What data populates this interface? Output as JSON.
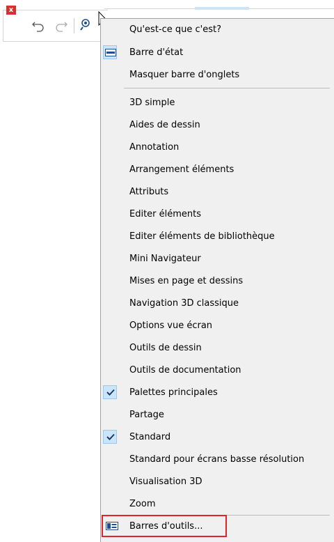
{
  "toolbar": {
    "close_glyph": "x",
    "icons": [
      "close-icon",
      "undo-icon",
      "redo-icon",
      "zoom-icon",
      "cursor-icon",
      "help-question-icon"
    ]
  },
  "menu": {
    "top_items": [
      {
        "label": "Qu'est-ce que c'est?",
        "icon": "help-question-icon"
      },
      {
        "label": "Barre d'état",
        "icon": "status-bar-icon",
        "highlighted": true
      },
      {
        "label": "Masquer barre d'onglets"
      }
    ],
    "items": [
      {
        "label": "3D simple"
      },
      {
        "label": "Aides de dessin"
      },
      {
        "label": "Annotation"
      },
      {
        "label": "Arrangement éléments"
      },
      {
        "label": "Attributs"
      },
      {
        "label": "Editer éléments"
      },
      {
        "label": "Editer éléments de bibliothèque"
      },
      {
        "label": "Mini Navigateur"
      },
      {
        "label": "Mises en page et dessins"
      },
      {
        "label": "Navigation 3D classique"
      },
      {
        "label": "Options vue écran"
      },
      {
        "label": "Outils de dessin"
      },
      {
        "label": "Outils de documentation"
      },
      {
        "label": "Palettes principales",
        "checked": true
      },
      {
        "label": "Partage"
      },
      {
        "label": "Standard",
        "checked": true
      },
      {
        "label": "Standard pour écrans basse résolution"
      },
      {
        "label": "Visualisation 3D"
      },
      {
        "label": "Zoom"
      }
    ],
    "bottom_item": {
      "label": "Barres d'outils...",
      "icon": "toolbars-icon",
      "outlined_color": "#e0242a"
    }
  },
  "colors": {
    "highlight_bg": "#cce4f7",
    "highlight_border": "#99c9ef",
    "check_color": "#1a3a6b"
  }
}
